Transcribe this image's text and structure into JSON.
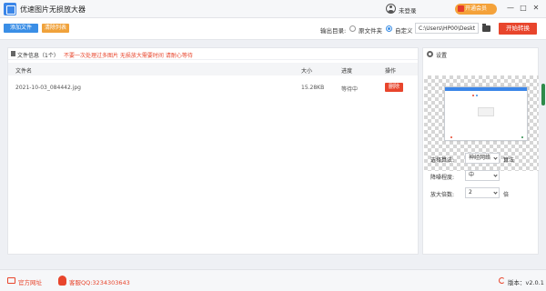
{
  "app": {
    "title": "优速图片无损放大器",
    "login_label": "未登录",
    "vip_label": "开通会员",
    "window_controls": [
      "—",
      "□",
      "✕"
    ]
  },
  "toolbar": {
    "add_files_label": "添加文件",
    "clear_list_label": "清除列表",
    "output_dir_label": "输出目录:",
    "radio_original": "原文件夹",
    "radio_custom": "自定义",
    "selected_output": "自定义",
    "path_value": "C:\\Users\\HP00\\Desktop",
    "start_label": "开始转换"
  },
  "file_panel": {
    "title": "文件信息（1个）",
    "hint": "不要一次处理过多图片 无损放大需要时间 请耐心等待",
    "columns": {
      "name": "文件名",
      "size": "大小",
      "progress": "进度",
      "action": "操作"
    },
    "rows": [
      {
        "name": "2021-10-03_084442.jpg",
        "size": "15.28KB",
        "progress": "等待中",
        "action": "删除"
      }
    ]
  },
  "settings": {
    "title": "设置",
    "algorithm": {
      "label": "选择算法:",
      "value": "神经网络",
      "suffix": "算法"
    },
    "denoise": {
      "label": "降噪程度:",
      "value": "中"
    },
    "scale": {
      "label": "放大倍数:",
      "value": "2",
      "suffix": "倍"
    }
  },
  "footer": {
    "website_label": "官方网址",
    "qq_label": "客服QQ:3234303643",
    "version_label": "版本：",
    "version_value": "v2.0.1"
  },
  "colors": {
    "primary": "#3a8ee6",
    "warning": "#f0a23b",
    "danger": "#e8452c"
  }
}
